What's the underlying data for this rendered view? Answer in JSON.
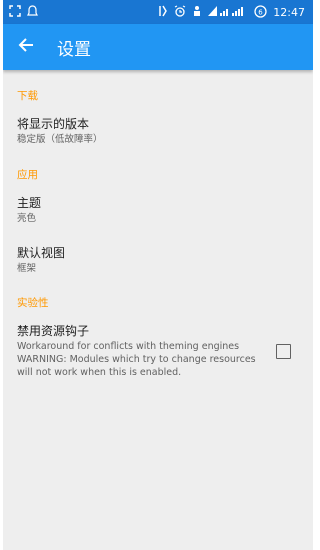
{
  "status_bar": {
    "left_icons": [
      "expand-icon",
      "notification-icon"
    ],
    "right_icons": [
      "network-icon",
      "alarm-icon",
      "person-icon",
      "signal-icon",
      "battery-icon"
    ],
    "time": "12:47",
    "color": "#1976d2"
  },
  "toolbar": {
    "title": "设置",
    "back_icon": "arrow-left-icon",
    "color": "#2196f3"
  },
  "sections": [
    {
      "header": "下载",
      "items": [
        {
          "title": "将显示的版本",
          "summary": "稳定版（低故障率）"
        }
      ]
    },
    {
      "header": "应用",
      "items": [
        {
          "title": "主题",
          "summary": "亮色"
        },
        {
          "title": "默认视图",
          "summary": "框架"
        }
      ]
    },
    {
      "header": "实验性",
      "items": [
        {
          "title": "禁用资源钩子",
          "summary": "Workaround for conflicts with theming engines WARNING: Modules which try to change resources will not work when this is enabled.",
          "checked": false
        }
      ]
    }
  ],
  "accent_color": "#ff9800"
}
